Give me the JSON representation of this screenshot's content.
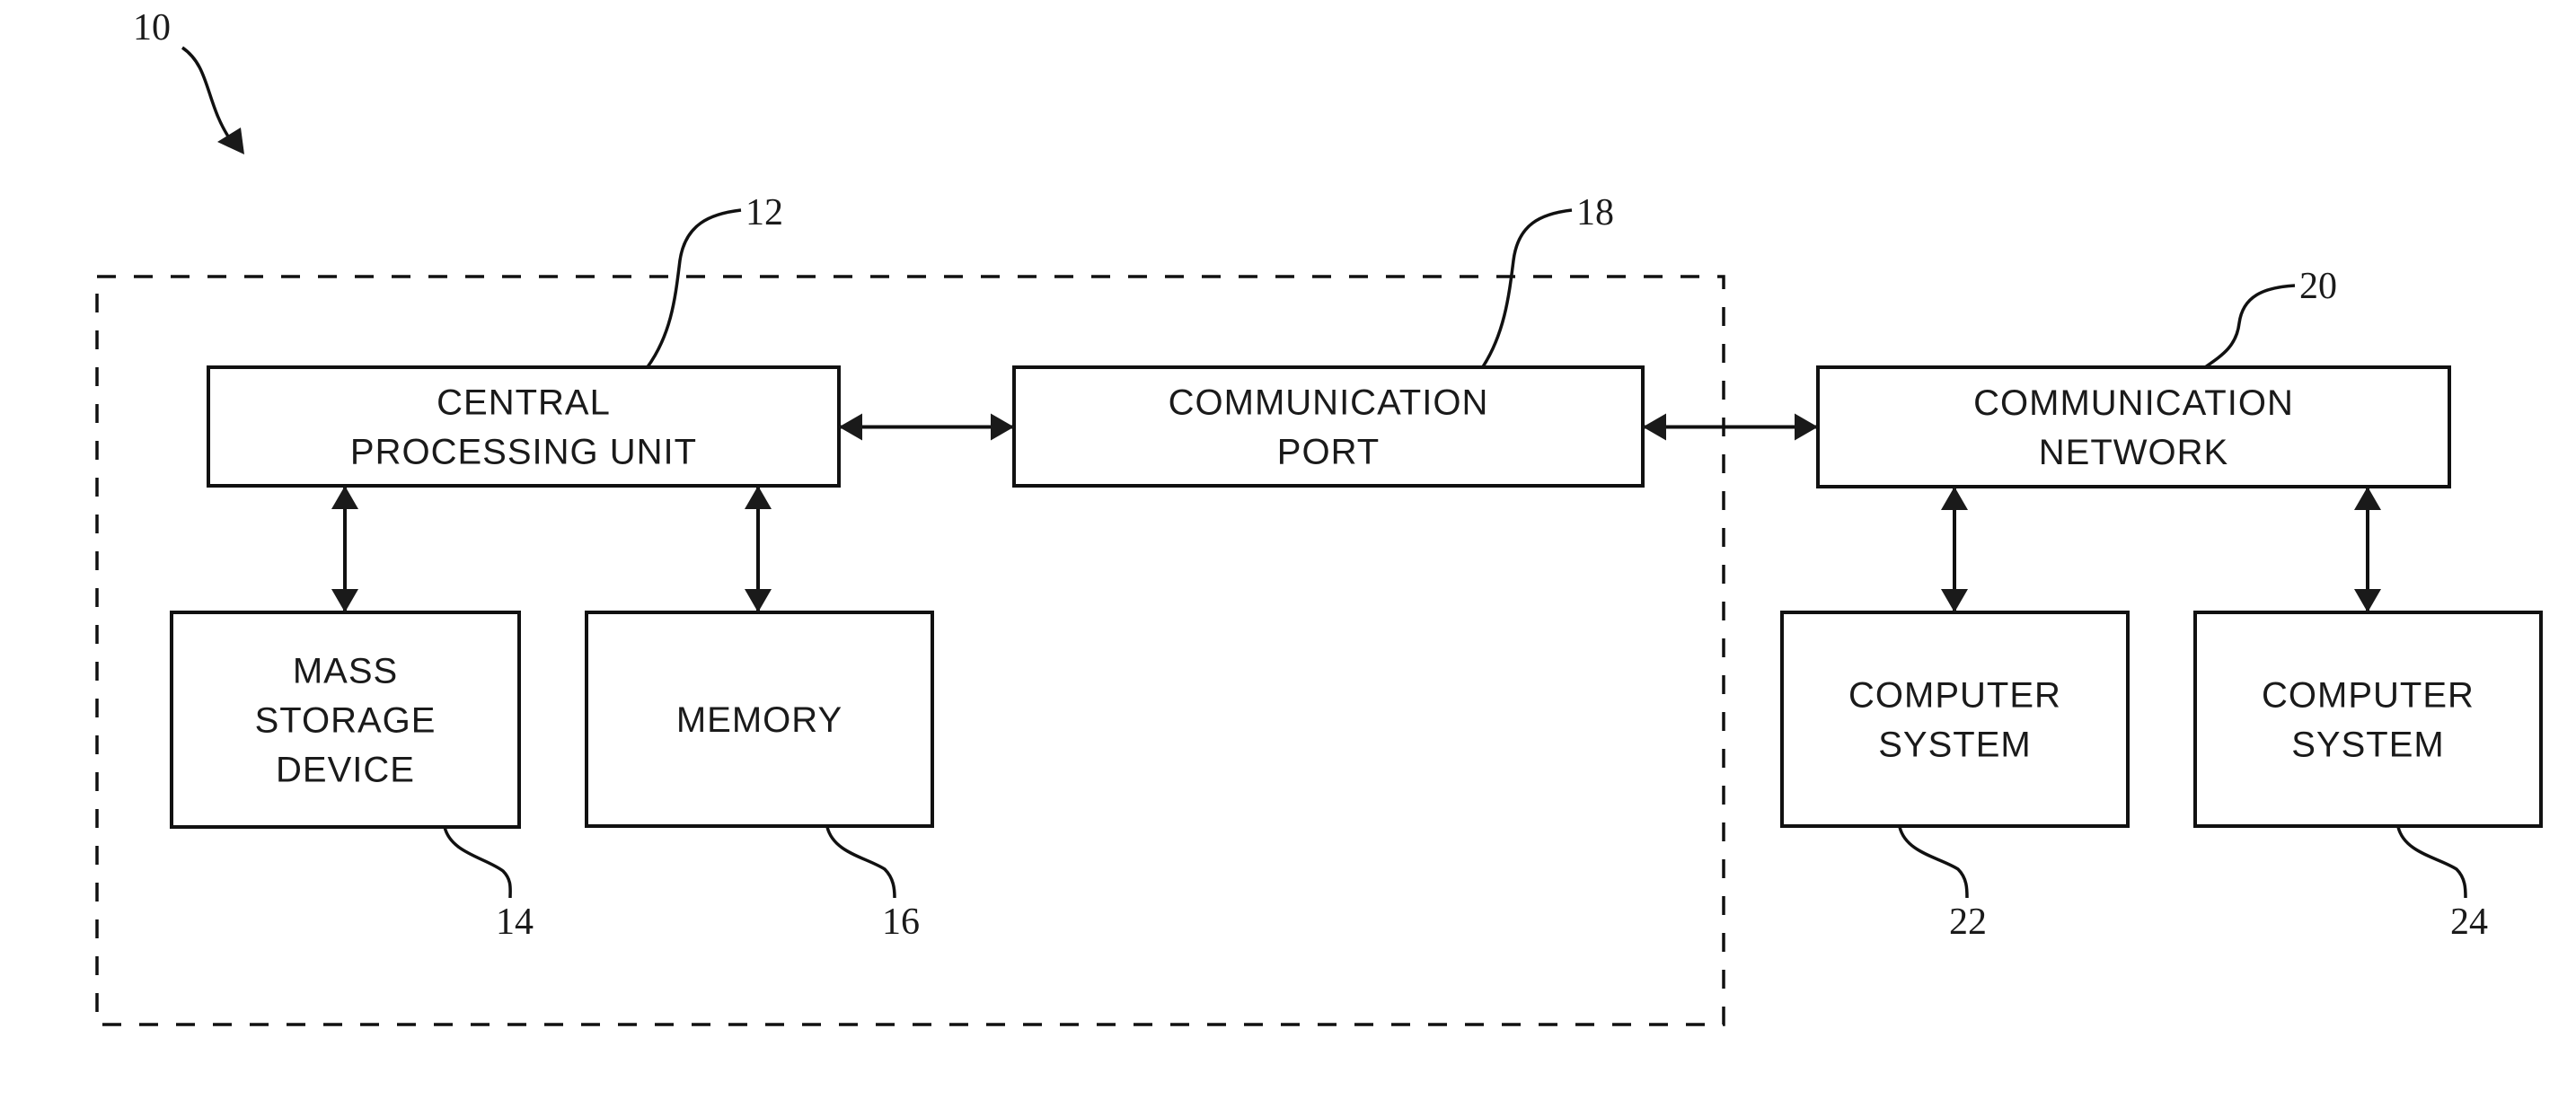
{
  "diagram": {
    "type": "block-diagram",
    "system_ref": "10",
    "boundary": {
      "encloses": [
        "cpu",
        "mass_storage",
        "memory",
        "comm_port"
      ],
      "style": "dashed"
    },
    "blocks": [
      {
        "id": "cpu",
        "ref": "12",
        "lines": [
          "CENTRAL",
          "PROCESSING UNIT"
        ]
      },
      {
        "id": "comm_port",
        "ref": "18",
        "lines": [
          "COMMUNICATION",
          "PORT"
        ]
      },
      {
        "id": "comm_network",
        "ref": "20",
        "lines": [
          "COMMUNICATION",
          "NETWORK"
        ]
      },
      {
        "id": "mass_storage",
        "ref": "14",
        "lines": [
          "MASS",
          "STORAGE",
          "DEVICE"
        ]
      },
      {
        "id": "memory",
        "ref": "16",
        "lines": [
          "MEMORY"
        ]
      },
      {
        "id": "computer_system_a",
        "ref": "22",
        "lines": [
          "COMPUTER",
          "SYSTEM"
        ]
      },
      {
        "id": "computer_system_b",
        "ref": "24",
        "lines": [
          "COMPUTER",
          "SYSTEM"
        ]
      }
    ],
    "connections": [
      {
        "from": "cpu",
        "to": "comm_port",
        "direction": "bidirectional"
      },
      {
        "from": "comm_port",
        "to": "comm_network",
        "direction": "bidirectional"
      },
      {
        "from": "cpu",
        "to": "mass_storage",
        "direction": "bidirectional"
      },
      {
        "from": "cpu",
        "to": "memory",
        "direction": "bidirectional"
      },
      {
        "from": "comm_network",
        "to": "computer_system_a",
        "direction": "bidirectional"
      },
      {
        "from": "comm_network",
        "to": "computer_system_b",
        "direction": "bidirectional"
      }
    ]
  },
  "colors": {
    "ink": "#111111",
    "background": "#ffffff"
  }
}
